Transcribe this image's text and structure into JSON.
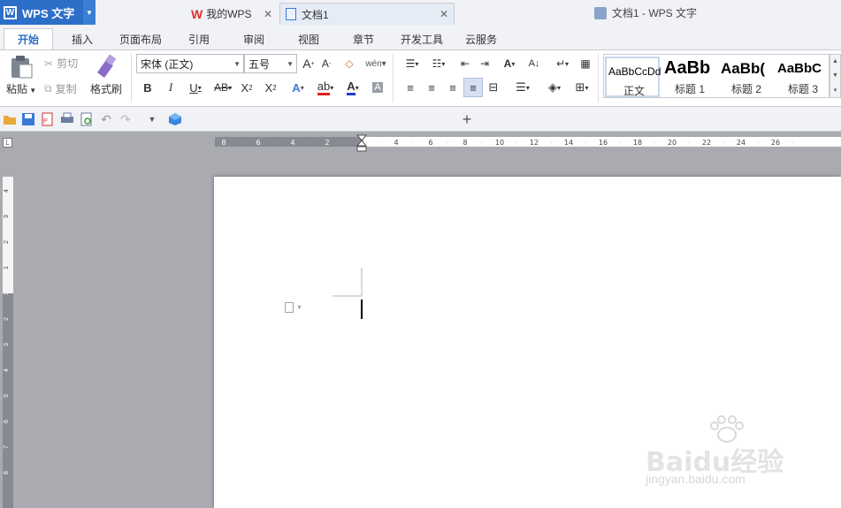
{
  "app": {
    "name": "WPS 文字",
    "window_title": "文档1 - WPS 文字"
  },
  "menu": {
    "tabs": [
      "开始",
      "插入",
      "页面布局",
      "引用",
      "审阅",
      "视图",
      "章节",
      "开发工具",
      "云服务"
    ],
    "active": "开始"
  },
  "ribbon": {
    "paste": "粘贴",
    "cut": "剪切",
    "copy": "复制",
    "format_painter": "格式刷",
    "font_name": "宋体 (正文)",
    "font_size": "五号",
    "styles": [
      {
        "preview": "AaBbCcDd",
        "label": "正文"
      },
      {
        "preview": "AaBb",
        "label": "标题 1"
      },
      {
        "preview": "AaBb(",
        "label": "标题 2"
      },
      {
        "preview": "AaBbC",
        "label": "标题 3"
      }
    ]
  },
  "doc_tabs": [
    {
      "label": "我的WPS"
    },
    {
      "label": "文档1"
    }
  ],
  "ruler": {
    "h_labels": [
      "8",
      "6",
      "4",
      "2",
      "2",
      "4",
      "6",
      "8",
      "10",
      "12",
      "14",
      "16",
      "18",
      "20",
      "22",
      "24",
      "26"
    ],
    "v_labels": [
      "4",
      "3",
      "2",
      "1",
      "1",
      "2",
      "3",
      "4",
      "5",
      "6",
      "7",
      "8"
    ]
  },
  "watermark": {
    "main": "Baidu经验",
    "sub": "jingyan.baidu.com"
  },
  "colors": {
    "accent": "#2c6fc9",
    "chrome": "#f0f2f5",
    "workspace": "#a9abb0",
    "font_color_red": "#e02020",
    "font_color_blue": "#1f3fd0"
  }
}
